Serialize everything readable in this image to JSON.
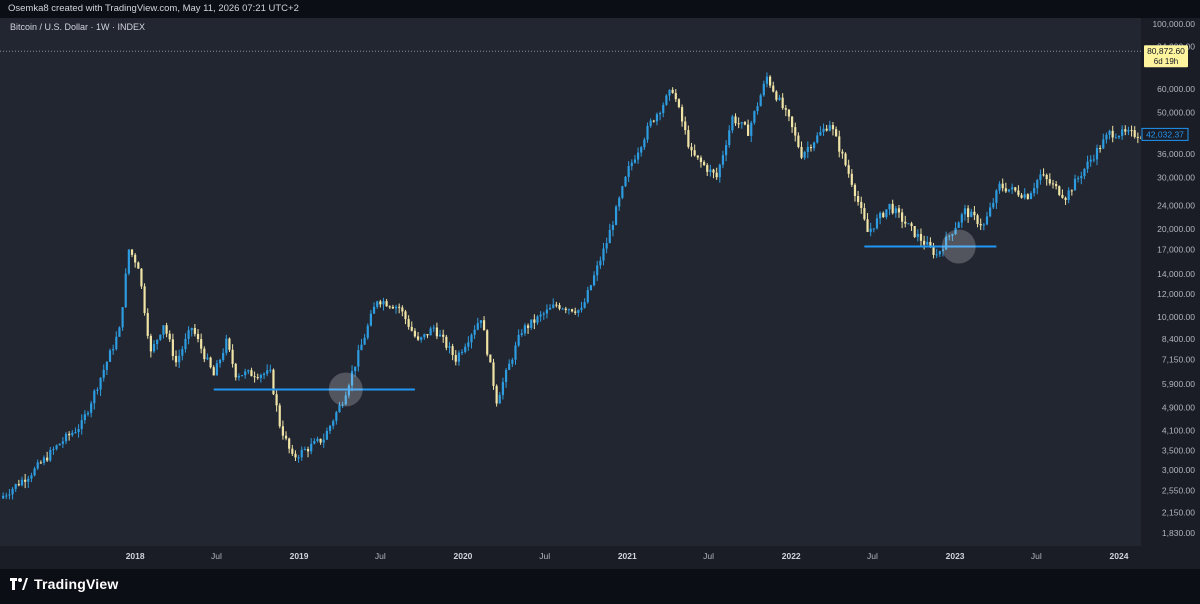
{
  "header": {
    "attribution": "Osemka8 created with TradingView.com, May 11, 2026 07:21 UTC+2"
  },
  "footer": {
    "brand": "TradingView",
    "logo_icon": "tradingview-logo-icon"
  },
  "colors": {
    "background": "#222630",
    "page": "#131722",
    "up_candle": "#2d9ce0",
    "down_candle": "#efe3a6",
    "support_line": "#2196f3",
    "axis_text": "#b2b5be",
    "last_price_bg": "#fff49e",
    "current_price": "#2196f3"
  },
  "chart_data": {
    "type": "candlestick",
    "title": "Bitcoin / U.S. Dollar · 1W · INDEX",
    "interval": "1W",
    "y_scale": "log",
    "ylim": [
      1650,
      105000
    ],
    "xlim": [
      "2017-03-06",
      "2024-02-19"
    ],
    "y_ticks": [
      "100,000.00",
      "84,000.00",
      "60,000.00",
      "50,000.00",
      "36,000.00",
      "30,000.00",
      "24,000.00",
      "20,000.00",
      "17,000.00",
      "14,000.00",
      "12,000.00",
      "10,000.00",
      "8,400.00",
      "7,150.00",
      "5,900.00",
      "4,900.00",
      "4,100.00",
      "3,500.00",
      "3,000.00",
      "2,550.00",
      "2,150.00",
      "1,830.00"
    ],
    "x_ticks": [
      {
        "label": "2018",
        "date": "2018-01-01",
        "bold": true
      },
      {
        "label": "Jul",
        "date": "2018-07-01",
        "bold": false
      },
      {
        "label": "2019",
        "date": "2019-01-01",
        "bold": true
      },
      {
        "label": "Jul",
        "date": "2019-07-01",
        "bold": false
      },
      {
        "label": "2020",
        "date": "2020-01-01",
        "bold": true
      },
      {
        "label": "Jul",
        "date": "2020-07-01",
        "bold": false
      },
      {
        "label": "2021",
        "date": "2021-01-01",
        "bold": true
      },
      {
        "label": "Jul",
        "date": "2021-07-01",
        "bold": false
      },
      {
        "label": "2022",
        "date": "2022-01-01",
        "bold": true
      },
      {
        "label": "Jul",
        "date": "2022-07-01",
        "bold": false
      },
      {
        "label": "2023",
        "date": "2023-01-01",
        "bold": true
      },
      {
        "label": "Jul",
        "date": "2023-07-01",
        "bold": false
      },
      {
        "label": "2024",
        "date": "2024-01-01",
        "bold": true
      }
    ],
    "price_path": [
      [
        "2017-03-06",
        2400
      ],
      [
        "2017-05-22",
        3000
      ],
      [
        "2017-07-17",
        3700
      ],
      [
        "2017-09-04",
        4300
      ],
      [
        "2017-11-27",
        9000
      ],
      [
        "2017-12-18",
        17000
      ],
      [
        "2018-01-08",
        15000
      ],
      [
        "2018-02-05",
        7500
      ],
      [
        "2018-03-05",
        9500
      ],
      [
        "2018-04-02",
        7000
      ],
      [
        "2018-05-07",
        9200
      ],
      [
        "2018-06-25",
        6300
      ],
      [
        "2018-07-23",
        8200
      ],
      [
        "2018-08-13",
        6400
      ],
      [
        "2018-10-29",
        6400
      ],
      [
        "2018-11-19",
        4300
      ],
      [
        "2018-12-17",
        3300
      ],
      [
        "2019-02-25",
        3850
      ],
      [
        "2019-04-08",
        5200
      ],
      [
        "2019-05-20",
        8000
      ],
      [
        "2019-06-24",
        11500
      ],
      [
        "2019-08-12",
        10800
      ],
      [
        "2019-09-23",
        8200
      ],
      [
        "2019-10-28",
        9200
      ],
      [
        "2019-12-16",
        7200
      ],
      [
        "2020-02-10",
        10000
      ],
      [
        "2020-03-16",
        5200
      ],
      [
        "2020-05-11",
        9000
      ],
      [
        "2020-07-27",
        11000
      ],
      [
        "2020-09-21",
        10500
      ],
      [
        "2020-11-16",
        18000
      ],
      [
        "2021-01-04",
        32000
      ],
      [
        "2021-02-22",
        46000
      ],
      [
        "2021-04-12",
        60000
      ],
      [
        "2021-05-24",
        36000
      ],
      [
        "2021-07-19",
        30000
      ],
      [
        "2021-08-23",
        48000
      ],
      [
        "2021-09-27",
        43000
      ],
      [
        "2021-11-08",
        66000
      ],
      [
        "2021-12-27",
        47000
      ],
      [
        "2022-01-24",
        36000
      ],
      [
        "2022-03-28",
        46000
      ],
      [
        "2022-05-16",
        29000
      ],
      [
        "2022-06-20",
        19500
      ],
      [
        "2022-08-08",
        24000
      ],
      [
        "2022-10-03",
        19300
      ],
      [
        "2022-11-21",
        16300
      ],
      [
        "2023-01-23",
        23000
      ],
      [
        "2023-03-06",
        20500
      ],
      [
        "2023-04-10",
        28000
      ],
      [
        "2023-06-12",
        26000
      ],
      [
        "2023-07-10",
        30500
      ],
      [
        "2023-09-04",
        25800
      ],
      [
        "2023-10-30",
        34500
      ],
      [
        "2023-12-11",
        42500
      ],
      [
        "2024-02-19",
        42032
      ]
    ],
    "annotations": [
      {
        "type": "horizontal_segment",
        "y": 5650,
        "x_start": "2018-06-25",
        "x_end": "2019-09-16"
      },
      {
        "type": "horizontal_segment",
        "y": 17400,
        "x_start": "2022-06-13",
        "x_end": "2023-04-03"
      },
      {
        "type": "highlight_circle",
        "x": "2019-04-15",
        "y": 5650
      },
      {
        "type": "highlight_circle",
        "x": "2023-01-09",
        "y": 17400
      }
    ],
    "reference_line": {
      "value": 80872.6
    },
    "last_price_label": {
      "value": "80,872.60",
      "sub": "6d 19h"
    },
    "current_price_label": {
      "value": "42,032.37"
    }
  }
}
